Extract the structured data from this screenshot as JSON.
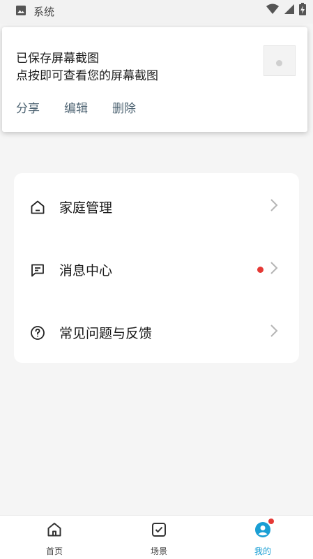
{
  "status_bar": {
    "app_label": "系统",
    "icons": [
      "image-icon",
      "wifi-icon",
      "signal-icon",
      "battery-charging-icon"
    ]
  },
  "notification": {
    "line1": "已保存屏幕截图",
    "line2": "点按即可查看您的屏幕截图",
    "actions": {
      "share": "分享",
      "edit": "编辑",
      "delete": "删除"
    },
    "accent_color": "#4d6372"
  },
  "menu": {
    "items": [
      {
        "label": "家庭管理",
        "icon": "home-icon",
        "has_badge": false
      },
      {
        "label": "消息中心",
        "icon": "message-icon",
        "has_badge": true
      },
      {
        "label": "常见问题与反馈",
        "icon": "help-icon",
        "has_badge": false
      }
    ],
    "badge_color": "#e53935"
  },
  "bottom_nav": {
    "items": [
      {
        "label": "首页",
        "icon": "home-icon",
        "active": false
      },
      {
        "label": "场景",
        "icon": "checkbox-icon",
        "active": false
      },
      {
        "label": "我的",
        "icon": "profile-icon",
        "active": true
      }
    ],
    "active_color": "#1a9fd4"
  }
}
